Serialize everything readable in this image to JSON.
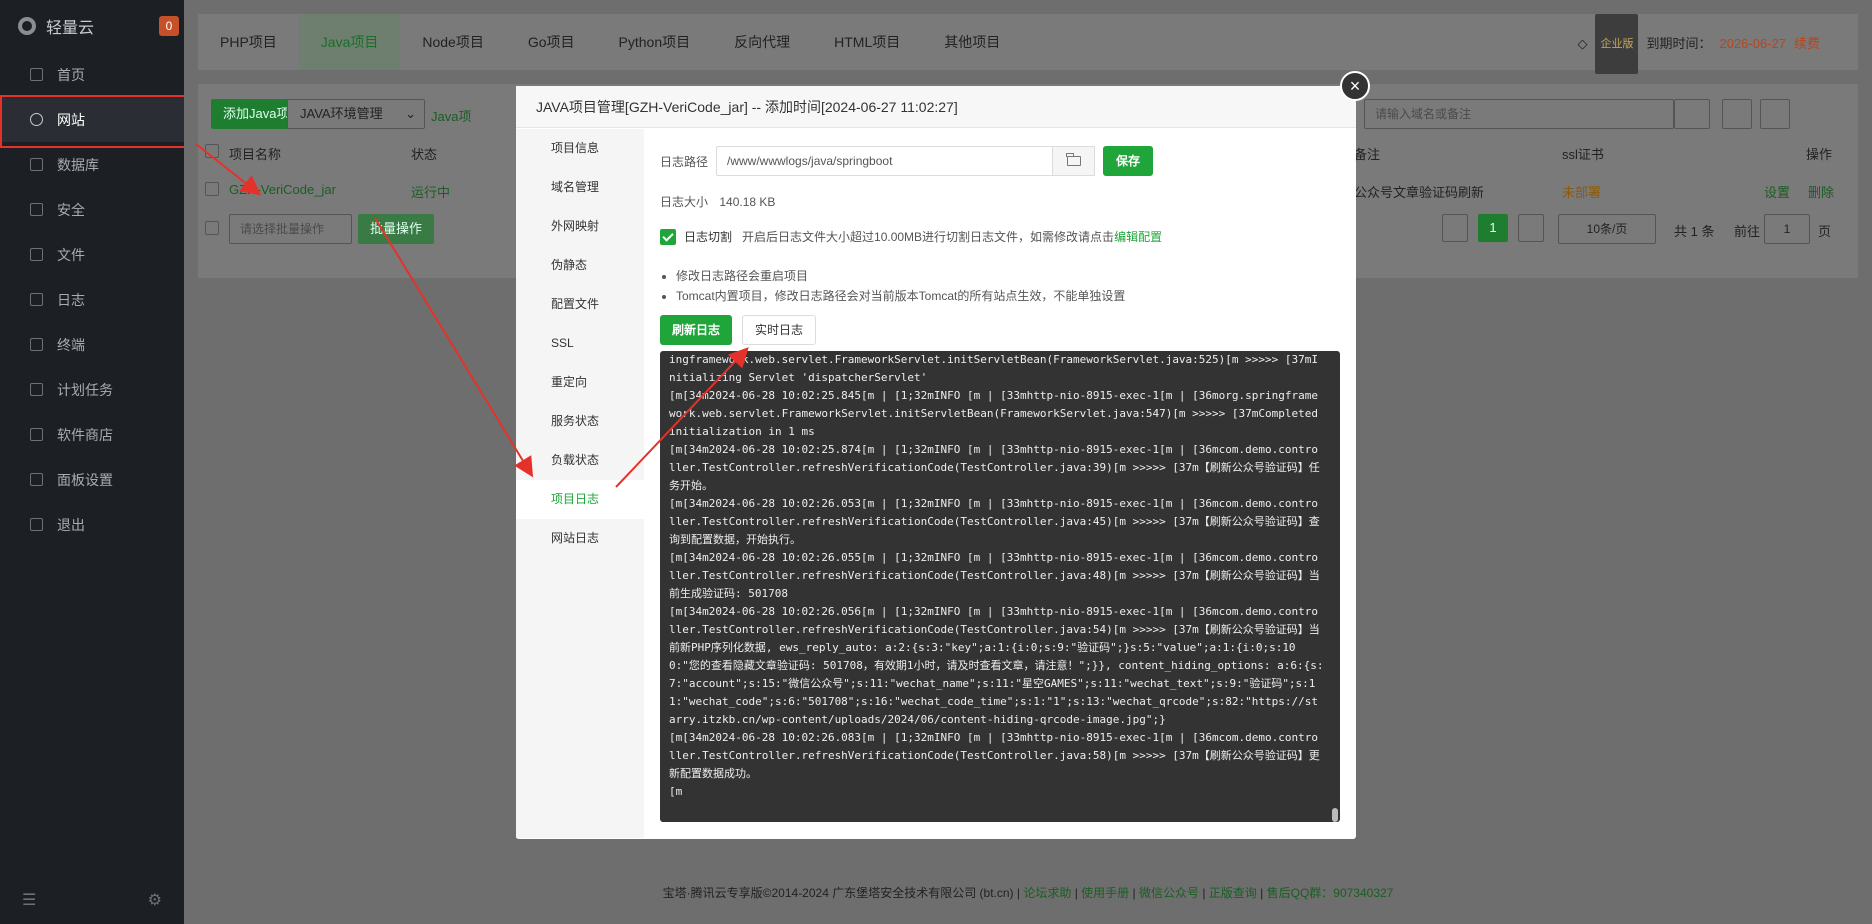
{
  "sidebar": {
    "brand": "轻量云",
    "badge": "0",
    "items": [
      {
        "label": "首页",
        "icon": "home-icon"
      },
      {
        "label": "网站",
        "icon": "globe-icon",
        "active": true
      },
      {
        "label": "数据库",
        "icon": "database-icon"
      },
      {
        "label": "安全",
        "icon": "shield-icon"
      },
      {
        "label": "文件",
        "icon": "folder-icon"
      },
      {
        "label": "日志",
        "icon": "log-icon"
      },
      {
        "label": "终端",
        "icon": "terminal-icon"
      },
      {
        "label": "计划任务",
        "icon": "clock-icon"
      },
      {
        "label": "软件商店",
        "icon": "store-icon"
      },
      {
        "label": "面板设置",
        "icon": "gear-icon"
      },
      {
        "label": "退出",
        "icon": "logout-icon"
      }
    ]
  },
  "topbar": {
    "tabs": [
      "PHP项目",
      "Java项目",
      "Node项目",
      "Go项目",
      "Python项目",
      "反向代理",
      "HTML项目",
      "其他项目"
    ],
    "active_tab": "Java项目",
    "edition": "企业版",
    "expiry_label": "到期时间：",
    "expiry_date": "2026-06-27",
    "renew": "续费"
  },
  "toolbar": {
    "add_button": "添加Java项目",
    "env_button": "JAVA环境管理",
    "java_tab_partial": "Java项",
    "search_placeholder": "请输入域名或备注"
  },
  "table": {
    "headers": {
      "name": "项目名称",
      "status": "状态",
      "remark": "备注",
      "ssl": "ssl证书",
      "ops": "操作"
    },
    "row": {
      "name": "GZH-VeriCode_jar",
      "status": "运行中",
      "remark": "公众号文章验证码刷新",
      "ssl": "未部署",
      "op_settings": "设置",
      "op_delete": "删除"
    },
    "batch_placeholder": "请选择批量操作",
    "batch_button": "批量操作",
    "pagination": {
      "page": "1",
      "per_page": "10条/页",
      "total": "共 1 条",
      "goto_label": "前往",
      "goto_value": "1",
      "goto_suffix": "页"
    }
  },
  "footer": {
    "copyright": "宝塔·腾讯云专享版©2014-2024 广东堡塔安全技术有限公司 (bt.cn)",
    "links": [
      "论坛求助",
      "使用手册",
      "微信公众号",
      "正版查询"
    ],
    "qq": "售后QQ群：907340327"
  },
  "modal": {
    "title": "JAVA项目管理[GZH-VeriCode_jar] -- 添加时间[2024-06-27 11:02:27]",
    "close": "×",
    "menu": [
      "项目信息",
      "域名管理",
      "外网映射",
      "伪静态",
      "配置文件",
      "SSL",
      "重定向",
      "服务状态",
      "负载状态",
      "项目日志",
      "网站日志"
    ],
    "active_menu": "项目日志",
    "log_path_label": "日志路径",
    "log_path_value": "/www/wwwlogs/java/springboot",
    "save_button": "保存",
    "log_size_label": "日志大小",
    "log_size_value": "140.18 KB",
    "cut_label": "日志切割",
    "cut_desc": "开启后日志文件大小超过10.00MB进行切割日志文件，如需修改请点击",
    "cut_link": "编辑配置",
    "tips": [
      "修改日志路径会重启项目",
      "Tomcat内置项目，修改日志路径会对当前版本Tomcat的所有站点生效，不能单独设置"
    ],
    "refresh_button": "刷新日志",
    "live_button": "实时日志",
    "console_lines": [
      "ingframework.web.servlet.FrameworkServlet.initServletBean(FrameworkServlet.java:525)\u001b[m >>>>> \u001b[37mInitializing Servlet 'dispatcherServlet'",
      "\u001b[m\u001b[34m2024-06-28 10:02:25.845\u001b[m | \u001b[1;32mINFO \u001b[m | \u001b[33mhttp-nio-8915-exec-1\u001b[m | \u001b[36morg.springframework.web.servlet.FrameworkServlet.initServletBean(FrameworkServlet.java:547)\u001b[m >>>>> \u001b[37mCompleted initialization in 1 ms",
      "\u001b[m\u001b[34m2024-06-28 10:02:25.874\u001b[m | \u001b[1;32mINFO \u001b[m | \u001b[33mhttp-nio-8915-exec-1\u001b[m | \u001b[36mcom.demo.controller.TestController.refreshVerificationCode(TestController.java:39)\u001b[m >>>>> \u001b[37m【刷新公众号验证码】任务开始。",
      "\u001b[m\u001b[34m2024-06-28 10:02:26.053\u001b[m | \u001b[1;32mINFO \u001b[m | \u001b[33mhttp-nio-8915-exec-1\u001b[m | \u001b[36mcom.demo.controller.TestController.refreshVerificationCode(TestController.java:45)\u001b[m >>>>> \u001b[37m【刷新公众号验证码】查询到配置数据，开始执行。",
      "\u001b[m\u001b[34m2024-06-28 10:02:26.055\u001b[m | \u001b[1;32mINFO \u001b[m | \u001b[33mhttp-nio-8915-exec-1\u001b[m | \u001b[36mcom.demo.controller.TestController.refreshVerificationCode(TestController.java:48)\u001b[m >>>>> \u001b[37m【刷新公众号验证码】当前生成验证码: 501708",
      "\u001b[m\u001b[34m2024-06-28 10:02:26.056\u001b[m | \u001b[1;32mINFO \u001b[m | \u001b[33mhttp-nio-8915-exec-1\u001b[m | \u001b[36mcom.demo.controller.TestController.refreshVerificationCode(TestController.java:54)\u001b[m >>>>> \u001b[37m【刷新公众号验证码】当前新PHP序列化数据, ews_reply_auto: a:2:{s:3:\"key\";a:1:{i:0;s:9:\"验证码\";}s:5:\"value\";a:1:{i:0;s:100:\"您的查看隐藏文章验证码: 501708，有效期1小时，请及时查看文章，请注意！\";}}, content_hiding_options: a:6:{s:7:\"account\";s:15:\"微信公众号\";s:11:\"wechat_name\";s:11:\"星空GAMES\";s:11:\"wechat_text\";s:9:\"验证码\";s:11:\"wechat_code\";s:6:\"501708\";s:16:\"wechat_code_time\";s:1:\"1\";s:13:\"wechat_qrcode\";s:82:\"https://starry.itzkb.cn/wp-content/uploads/2024/06/content-hiding-qrcode-image.jpg\";}",
      "\u001b[m\u001b[34m2024-06-28 10:02:26.083\u001b[m | \u001b[1;32mINFO \u001b[m | \u001b[33mhttp-nio-8915-exec-1\u001b[m | \u001b[36mcom.demo.controller.TestController.refreshVerificationCode(TestController.java:58)\u001b[m >>>>> \u001b[37m【刷新公众号验证码】更新配置数据成功。",
      "\u001b[m"
    ]
  },
  "colors": {
    "accent": "#20a53a",
    "annotation": "#e4322a",
    "console_bg": "#333333"
  }
}
